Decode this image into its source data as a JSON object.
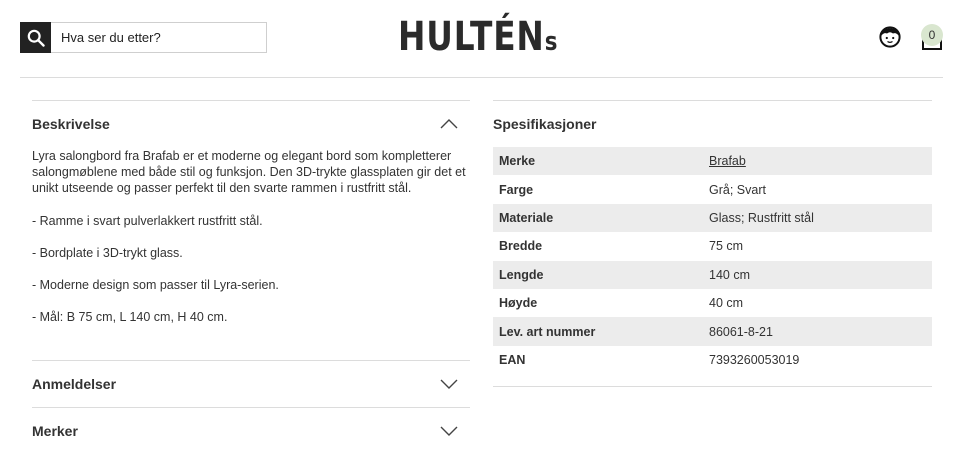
{
  "header": {
    "search_placeholder": "Hva ser du etter?",
    "logo_text_main": "HULTÉN",
    "logo_text_small": "s",
    "cart_count": "0"
  },
  "description": {
    "title": "Beskrivelse",
    "paragraphs": [
      "Lyra salongbord fra Brafab er et moderne og elegant bord som kompletterer salongmøblene med både stil og funksjon. Den 3D-trykte glassplaten gir det et unikt utseende og passer perfekt til den svarte rammen i rustfritt stål.",
      "- Ramme i svart pulverlakkert rustfritt stål.",
      "- Bordplate i 3D-trykt glass.",
      "- Moderne design som passer til Lyra-serien.",
      "- Mål: B 75 cm, L 140 cm, H 40 cm."
    ]
  },
  "reviews": {
    "title": "Anmeldelser"
  },
  "brands": {
    "title": "Merker"
  },
  "specs": {
    "title": "Spesifikasjoner",
    "rows": [
      {
        "key": "Merke",
        "value": "Brafab"
      },
      {
        "key": "Farge",
        "value": "Grå; Svart"
      },
      {
        "key": "Materiale",
        "value": "Glass; Rustfritt stål"
      },
      {
        "key": "Bredde",
        "value": "75 cm"
      },
      {
        "key": "Lengde",
        "value": "140 cm"
      },
      {
        "key": "Høyde",
        "value": "40 cm"
      },
      {
        "key": "Lev. art nummer",
        "value": "86061-8-21"
      },
      {
        "key": "EAN",
        "value": "7393260053019"
      }
    ]
  }
}
